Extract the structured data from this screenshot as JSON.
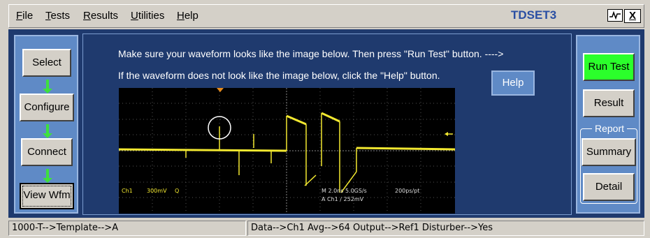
{
  "menu": {
    "file": "File",
    "tests": "Tests",
    "results": "Results",
    "utilities": "Utilities",
    "help": "Help"
  },
  "app_name": "TDSET3",
  "window_controls": {
    "close": "X"
  },
  "left_buttons": {
    "select": "Select",
    "configure": "Configure",
    "connect": "Connect",
    "view_wfm": "View Wfm"
  },
  "instructions": {
    "line1": "Make sure your waveform looks like the image below. Then press \"Run Test\" button. ---->",
    "line2": "If the waveform does not look like the image below, click the \"Help\" button."
  },
  "help_button": "Help",
  "waveform": {
    "ch1_label": "Ch1",
    "ch1_scale": "300mV",
    "ch1_flag": "Q",
    "timebase": "M 2.0ns 5.0GS/s",
    "resolution": "200ps/pt",
    "trigger": "A Ch1 ∕ 252mV"
  },
  "right_buttons": {
    "run_test": "Run Test",
    "result": "Result",
    "report_group": "Report",
    "summary": "Summary",
    "detail": "Detail"
  },
  "status": {
    "left": "1000-T-->Template-->A",
    "right": "Data-->Ch1   Avg-->64   Output-->Ref1   Disturber-->Yes"
  },
  "colors": {
    "frame": "#1f3a6e",
    "panel": "#5f8ac6",
    "run_test": "#2bff2b",
    "trace": "#f2e830",
    "arrow": "#3ee03e"
  }
}
